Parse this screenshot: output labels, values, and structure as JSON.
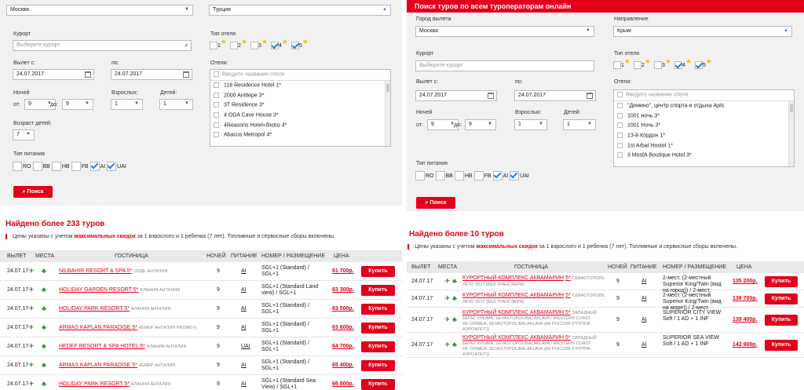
{
  "left": {
    "top_select_1": "Москва",
    "top_select_2": "Турция",
    "resort_label": "Курорт",
    "resort_placeholder": "Выберите курорт",
    "hotel_type_label": "Тип отеля",
    "stars": [
      "1",
      "2",
      "3",
      "4",
      "5"
    ],
    "stars_checked": [
      false,
      false,
      false,
      true,
      true
    ],
    "depart_from_label": "Вылет с:",
    "depart_to_label": "по:",
    "date_from": "24.07.2017",
    "date_to": "24.07.2017",
    "hotels_label": "Отели:",
    "hotels_placeholder": "Введите название отеля",
    "hotels": [
      "116 Residence Hotel 1*",
      "2000 Anittepe 3*",
      "3T Residence 3*",
      "4 ODA Cave House 3*",
      "4Reasons Hotel+Bistro 4*",
      "Abacus Metropol 4*"
    ],
    "nights_label": "Ночей",
    "nights_from_label": "от:",
    "nights_from": "9",
    "nights_to_label": "до:",
    "nights_to": "9",
    "adults_label": "Взрослых:",
    "adults": "1",
    "children_label": "Детей:",
    "children": "1",
    "child_age_label": "Возраст детей:",
    "child_age": "7",
    "meal_label": "Тип питания",
    "meals": [
      "RO",
      "BB",
      "HB",
      "FB",
      "AI",
      "UAI"
    ],
    "meals_checked": [
      false,
      false,
      false,
      false,
      true,
      true
    ],
    "search_button": "Поиск",
    "found": "Найдено более 233 туров",
    "note_pre": "Цены указаны с учетом ",
    "note_bold": "максимальных скидок",
    "note_post": " за 1 взрослого и 1 ребенка (7 лет). Топливные и сервисные сборы включены.",
    "columns": [
      "ВЫЛЕТ",
      "МЕСТА",
      "ГОСТИНИЦА",
      "НОЧЕЙ",
      "ПИТАНИЕ",
      "НОМЕР / РАЗМЕЩЕНИЕ",
      "ЦЕНА"
    ],
    "rows": [
      {
        "date": "24.07.17",
        "hotel": "NILBAHIR RESORT & SPA 5*",
        "region": "СИДЕ АНТАЛИЯ",
        "nights": "9",
        "meal": "AI",
        "room": [
          "SGL+1 (Standard) /",
          "SGL+1"
        ],
        "price": "61 700р.",
        "buy": "Купить"
      },
      {
        "date": "24.07.17",
        "hotel": "HOLIDAY GARDEN RESORT 5*",
        "region": "АЛАНИЯ АНТАЛИЯ",
        "nights": "9",
        "meal": "AI",
        "room": [
          "SGL+1 (Standard Land",
          "view) / SGL+1"
        ],
        "price": "63 300р.",
        "buy": "Купить"
      },
      {
        "date": "24.07.17",
        "hotel": "HOLIDAY PARK RESORT 5*",
        "region": "АЛАНИЯ АНТАЛИЯ",
        "nights": "9",
        "meal": "AI",
        "room": [
          "SGL+1 (Standard) /",
          "SGL+1"
        ],
        "price": "63 500р.",
        "buy": "Купить"
      },
      {
        "date": "24.07.17",
        "hotel": "ARMAS KAPLAN PARADISE 5*",
        "region": "КЕМЕР АНТАЛИЯ PROMO 6",
        "nights": "9",
        "meal": "AI",
        "room": [
          "SGL+1 (Standard) /",
          "SGL+1"
        ],
        "price": "63 600р.",
        "buy": "Купить"
      },
      {
        "date": "24.07.17",
        "hotel": "HEDEF RESORT & SPA HOTEL 5*",
        "region": "АЛАНИЯ АНТАЛИЯ",
        "nights": "9",
        "meal": "UAI",
        "room": [
          "SGL+1 (Standard) /",
          "SGL+1"
        ],
        "price": "64 700р.",
        "buy": "Купить"
      },
      {
        "date": "24.07.17",
        "hotel": "ARMAS KAPLAN PARADISE 5*",
        "region": "КЕМЕР АНТАЛИЯ",
        "nights": "9",
        "meal": "AI",
        "room": [
          "SGL+1 (Standard) /",
          "SGL+1"
        ],
        "price": "65 400р.",
        "buy": "Купить"
      },
      {
        "date": "24.07.17",
        "hotel": "HOLIDAY PARK RESORT 5*",
        "region": "АЛАНИЯ АНТАЛИЯ",
        "nights": "9",
        "meal": "AI",
        "room": [
          "SGL+1 (Standard Sea",
          "View) / SGL+1"
        ],
        "price": "66 800р.",
        "buy": "Купить"
      }
    ]
  },
  "right": {
    "header": "Поиск туров по всем туроператорам онлайн",
    "city_label": "Город вылета",
    "city": "Москва",
    "direction_label": "Направление",
    "direction": "Крым",
    "resort_label": "Курорт",
    "resort_placeholder": "Выберите курорт",
    "hotel_type_label": "Тип отеля",
    "stars": [
      "1",
      "2",
      "3",
      "4",
      "5"
    ],
    "stars_checked": [
      false,
      false,
      false,
      true,
      true
    ],
    "depart_from_label": "Вылет с:",
    "depart_to_label": "по:",
    "date_from": "24.07.2017",
    "date_to": "24.07.2017",
    "hotels_label": "Отели:",
    "hotels_placeholder": "Введите название отеля",
    "hotels": [
      "\"Демино\", центр спорта и отдыха Apts",
      "1001 ночь 3*",
      "1001 Ночь 3*",
      "13-й Кордон 1*",
      "1st Arbat Hostel 1*",
      "3 MostA Boutique Hotel 3*"
    ],
    "nights_label": "Ночей",
    "nights_from_label": "от:",
    "nights_from": "9",
    "nights_to_label": "до:",
    "nights_to": "9",
    "adults_label": "Взрослых:",
    "adults": "1",
    "children_label": "Детей:",
    "children": "1",
    "meal_label": "Тип питания",
    "meals": [
      "RO",
      "BB",
      "HB",
      "FB",
      "AI",
      "UAI"
    ],
    "meals_checked": [
      false,
      false,
      false,
      false,
      true,
      true
    ],
    "search_button": "Поиск",
    "found": "Найдено более 10 туров",
    "note_pre": "Цены указаны с учетом ",
    "note_bold": "максимальных скидок",
    "note_post": " за 1 взрослого и 1 ребенка (7 лет). Топливные и сервисные сборы включены.",
    "columns": [
      "ВЫЛЕТ",
      "МЕСТА",
      "ГОСТИНИЦА",
      "НОЧЕЙ",
      "ПИТАНИЕ",
      "НОМЕР / РАЗМЕЩЕНИЕ",
      "ЦЕНА"
    ],
    "rows": [
      {
        "date": "24.07.17",
        "hotel": [
          "КУРОРТНЫЙ КОМПЛЕКС АКВАМАРИН",
          "5*"
        ],
        "region": [
          "СЕВАСТОПОЛЬ ЛЕТО 2017 (БЕЗ ТРАНСФЕРА)"
        ],
        "nights": "9",
        "meal": "AI",
        "room": [
          "2-мест. (2-местный",
          "Superior King/Twin (вид",
          "на город)) / 2-мест."
        ],
        "price": "135 200р.",
        "buy": "Купить"
      },
      {
        "date": "24.07.17",
        "hotel": [
          "КУРОРТНЫЙ КОМПЛЕКС АКВАМАРИН",
          "5*"
        ],
        "region": [
          "СЕВАСТОПОЛЬ ЛЕТО 2017 (БЕЗ ТРАНСФЕРА)"
        ],
        "nights": "9",
        "meal": "AI",
        "room": [
          "2-мест. (2-местный",
          "Superior King/Twin (вид",
          "на море)) / 2-мест."
        ],
        "price": "138 700р.",
        "buy": "Купить"
      },
      {
        "date": "24.07.17",
        "hotel": [
          "КУРОРТНЫЙ КОМПЛЕКС АКВАМАРИН 5*"
        ],
        "region": [
          "ЗАПАДНЫЙ",
          "БЕРЕГ КРЫМА, SEVASTOPOL/BALAKLAVA / WESTERN COAST",
          "OF CRIMEA, SEVASTOPOL/BALAKLAVA (АК РОССИЯ (ГРУППА",
          "АЭРОФЛОТ))"
        ],
        "nights": "9",
        "meal": "AI",
        "room": [
          "SUPERIOR CITY VIEW",
          "Soft / 1 AD + 1 INF"
        ],
        "price": "139 400р.",
        "buy": "Купить"
      },
      {
        "date": "24.07.17",
        "hotel": [
          "КУРОРТНЫЙ КОМПЛЕКС АКВАМАРИН 5*"
        ],
        "region": [
          "ЗАПАДНЫЙ",
          "БЕРЕГ КРЫМА, SEVASTOPOL/BALAKLAVA / WESTERN COAST",
          "OF CRIMEA, SEVASTOPOL/BALAKLAVA (АК РОССИЯ (ГРУППА",
          "АЭРОФЛОТ))"
        ],
        "nights": "9",
        "meal": "AI",
        "room": [
          "SUPERIOR SEA VIEW",
          "Soft / 1 AD + 1 INF"
        ],
        "price": "142 900р.",
        "buy": "Купить"
      }
    ]
  },
  "colors": {
    "accent": "#e2001a",
    "form_bg": "#f1f1f1",
    "check": "#2a7fd4",
    "star": "#f2c200"
  },
  "icons": [
    "chevron-down-icon",
    "chevron-up-icon",
    "search-icon",
    "calendar-icon",
    "star-icon",
    "plane-icon",
    "tree-icon",
    "checkmark-icon",
    "scrollbar"
  ]
}
